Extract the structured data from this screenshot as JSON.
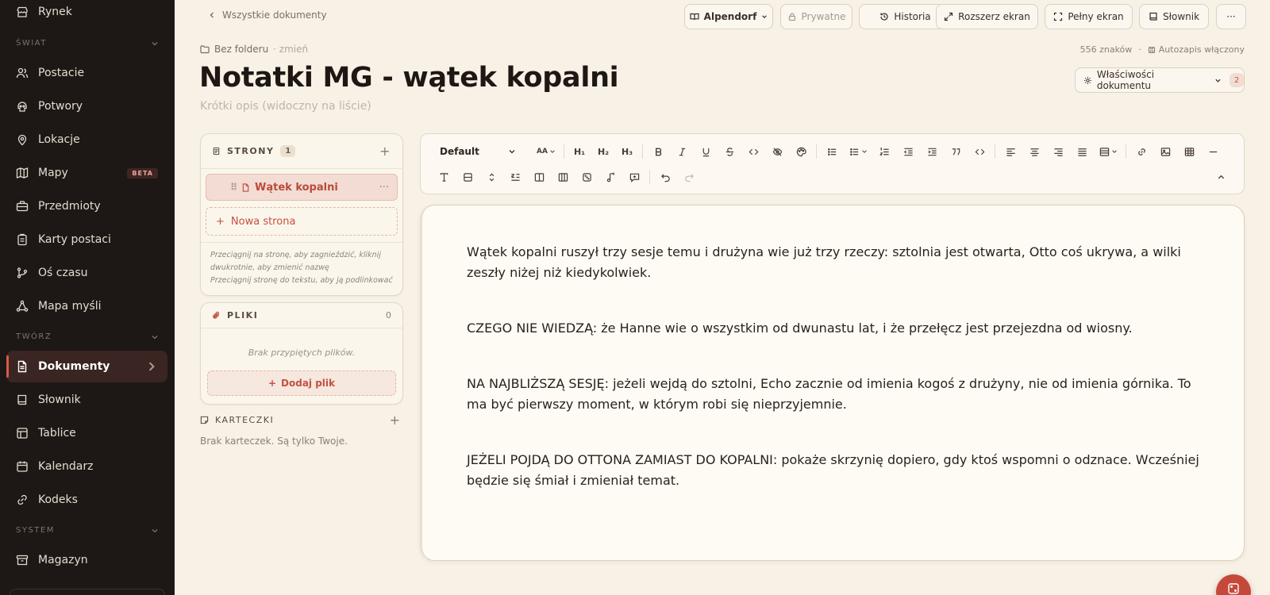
{
  "sidebar": {
    "top_item": "Rynek",
    "sections": {
      "world": "ŚWIAT",
      "create": "TWÓRZ",
      "system": "SYSTEM"
    },
    "world_items": [
      "Postacie",
      "Potwory",
      "Lokacje",
      "Mapy",
      "Przedmioty",
      "Karty postaci",
      "Oś czasu",
      "Mapa myśli"
    ],
    "beta_badge": "BETA",
    "create_items": [
      "Dokumenty",
      "Słownik",
      "Tablice",
      "Kalendarz",
      "Kodeks"
    ],
    "system_items": [
      "Magazyn"
    ]
  },
  "topbar": {
    "back": "Wszystkie dokumenty",
    "world": "Alpendorf",
    "private": "Prywatne",
    "history": "Historia",
    "expand": "Rozszerz ekran",
    "fullscreen": "Pełny ekran",
    "glossary": "Słownik",
    "more": "···"
  },
  "doc": {
    "folder": "Bez folderu",
    "folder_change": "· zmień",
    "chars": "556 znaków",
    "meta_sep": "·",
    "autosave": "Autozapis włączony",
    "title": "Notatki MG - wątek kopalni",
    "description_placeholder": "Krótki opis (widoczny na liście)",
    "properties": "Właściwości dokumentu",
    "properties_count": "2"
  },
  "pages_panel": {
    "title": "STRONY",
    "count": "1",
    "plus": "+",
    "page": "Wątek kopalni",
    "page_grip": "⠿",
    "page_more": "···",
    "new_page": "Nowa strona",
    "hint1": "Przeciągnij na stronę, aby zagnieździć, kliknij dwukrotnie, aby zmienić nazwę",
    "hint2": "Przeciągnij stronę do tekstu, aby ją podlinkować"
  },
  "files_panel": {
    "title": "PLIKI",
    "count": "0",
    "empty": "Brak przypiętych plików.",
    "add": "Dodaj plik"
  },
  "cards": {
    "title": "KARTECZKI",
    "plus": "+",
    "empty": "Brak karteczek. Są tylko Twoje."
  },
  "toolbar": {
    "style": "Default",
    "font_size": "AA",
    "h1": "H₁",
    "h2": "H₂",
    "h3": "H₃"
  },
  "editor": {
    "paragraphs": [
      "Wątek kopalni ruszył trzy sesje temu i drużyna wie już trzy rzeczy: sztolnia jest otwarta, Otto coś ukrywa, a wilki zeszły niżej niż kiedykolwiek.",
      "CZEGO NIE WIEDZĄ: że Hanne wie o wszystkim od dwunastu lat, i że przełęcz jest przejezdna od wiosny.",
      "NA NAJBLIŻSZĄ SESJĘ: jeżeli wejdą do sztolni, Echo zacznie od imienia kogoś z drużyny, nie od imienia górnika. To ma być pierwszy moment, w którym robi się nieprzyjemnie.",
      "JEŻELI POJDĄ DO OTTONA ZAMIAST DO KOPALNI: pokaże skrzynię dopiero, gdy ktoś wspomni o odznace. Wcześniej będzie się śmiał i zmieniał temat."
    ]
  }
}
